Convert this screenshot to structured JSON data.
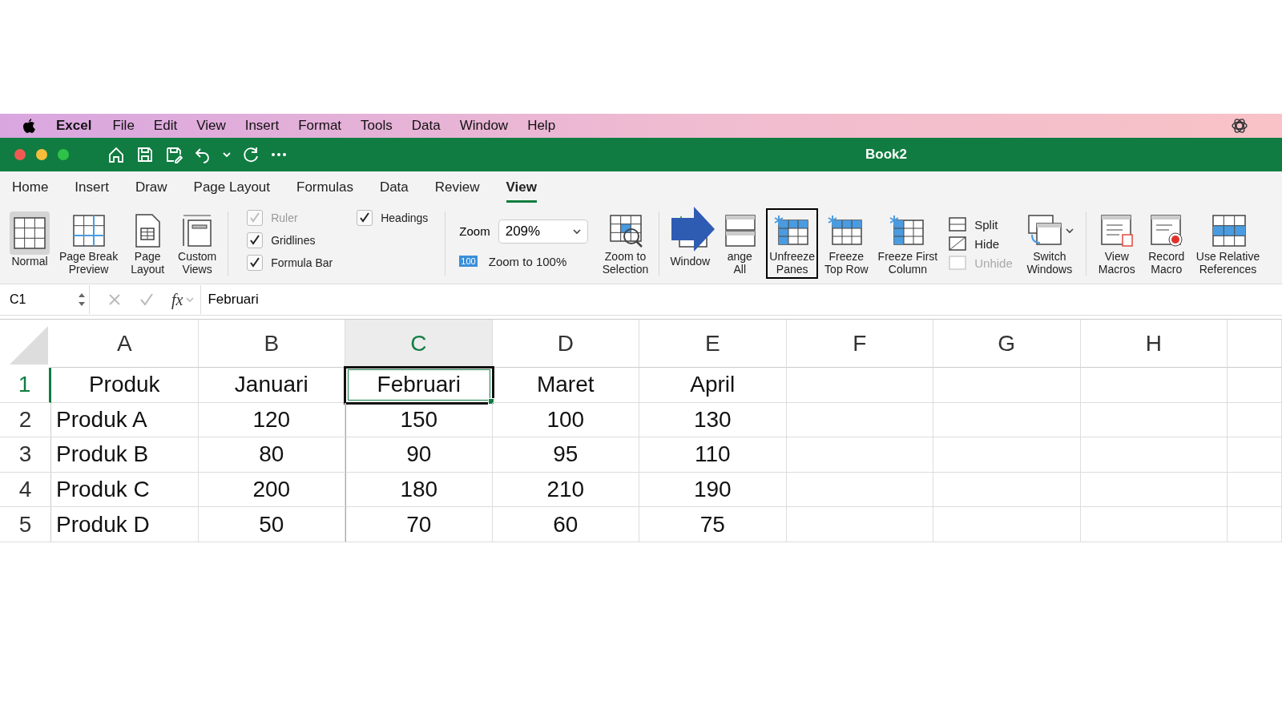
{
  "menu_bar": {
    "app": "Excel",
    "items": [
      "File",
      "Edit",
      "View",
      "Insert",
      "Format",
      "Tools",
      "Data",
      "Window",
      "Help"
    ]
  },
  "window": {
    "title": "Book2"
  },
  "tabs": [
    {
      "label": "Home",
      "selected": false
    },
    {
      "label": "Insert",
      "selected": false
    },
    {
      "label": "Draw",
      "selected": false
    },
    {
      "label": "Page Layout",
      "selected": false
    },
    {
      "label": "Formulas",
      "selected": false
    },
    {
      "label": "Data",
      "selected": false
    },
    {
      "label": "Review",
      "selected": false
    },
    {
      "label": "View",
      "selected": true
    }
  ],
  "ribbon": [
    {
      "items": [
        {
          "kind": "large",
          "lines": [
            "Normal"
          ],
          "selected": true
        },
        {
          "kind": "large",
          "lines": [
            "Page Break",
            "Preview"
          ],
          "selected": false
        },
        {
          "kind": "large",
          "lines": [
            "Page",
            "Layout"
          ],
          "selected": false
        },
        {
          "kind": "large",
          "lines": [
            "Custom",
            "Views"
          ],
          "selected": false
        }
      ]
    },
    {
      "items": [
        {
          "kind": "checks",
          "checks": [
            {
              "label": "Ruler",
              "checked": true,
              "disabled": true
            },
            {
              "label": "Gridlines",
              "checked": true,
              "disabled": false
            },
            {
              "label": "Formula Bar",
              "checked": true,
              "disabled": false
            }
          ]
        },
        {
          "kind": "checks",
          "checks": [
            {
              "label": "Headings",
              "checked": true,
              "disabled": false
            }
          ]
        }
      ]
    },
    {
      "items": [
        {
          "kind": "zoom",
          "label": "Zoom",
          "value": "209%",
          "badge": "100",
          "reset": "Zoom to 100%"
        },
        {
          "kind": "large",
          "lines": [
            "Zoom to",
            "Selection"
          ]
        }
      ]
    },
    {
      "items": [
        {
          "kind": "large",
          "lines": [
            "Window"
          ],
          "outlined": false
        },
        {
          "kind": "large",
          "lines": [
            "ange",
            "All"
          ],
          "outlined": false
        },
        {
          "kind": "large",
          "lines": [
            "Unfreeze",
            "Panes"
          ],
          "outlined": true
        },
        {
          "kind": "large",
          "lines": [
            "Freeze",
            "Top Row"
          ],
          "outlined": false
        },
        {
          "kind": "large",
          "lines": [
            "Freeze First",
            "Column"
          ],
          "outlined": false
        },
        {
          "kind": "stack",
          "buttons": [
            {
              "label": "Split",
              "disabled": false
            },
            {
              "label": "Hide",
              "disabled": false
            },
            {
              "label": "Unhide",
              "disabled": true
            }
          ]
        },
        {
          "kind": "large",
          "lines": [
            "Switch",
            "Windows"
          ]
        }
      ]
    },
    {
      "items": [
        {
          "kind": "large",
          "lines": [
            "View",
            "Macros"
          ]
        },
        {
          "kind": "large",
          "lines": [
            "Record",
            "Macro"
          ]
        },
        {
          "kind": "large",
          "lines": [
            "Use Relative",
            "References"
          ]
        }
      ]
    }
  ],
  "formula_bar": {
    "name_box": "C1",
    "function_label": "fx",
    "value": "Februari"
  },
  "sheet": {
    "columns": [
      {
        "label": "A",
        "selected": false
      },
      {
        "label": "B",
        "selected": false
      },
      {
        "label": "C",
        "selected": true
      },
      {
        "label": "D",
        "selected": false
      },
      {
        "label": "E",
        "selected": false
      },
      {
        "label": "F",
        "selected": false
      },
      {
        "label": "G",
        "selected": false
      },
      {
        "label": "H",
        "selected": false
      }
    ],
    "rows": [
      {
        "label": "1",
        "selected": true,
        "cells": [
          {
            "text": "Produk",
            "selected": false
          },
          {
            "text": "Januari",
            "selected": false
          },
          {
            "text": "Februari",
            "selected": true
          },
          {
            "text": "Maret",
            "selected": false
          },
          {
            "text": "April",
            "selected": false
          }
        ]
      },
      {
        "label": "2",
        "selected": false,
        "cells": [
          {
            "text": "Produk A",
            "selected": false
          },
          {
            "text": "120",
            "selected": false
          },
          {
            "text": "150",
            "selected": false
          },
          {
            "text": "100",
            "selected": false
          },
          {
            "text": "130",
            "selected": false
          }
        ]
      },
      {
        "label": "3",
        "selected": false,
        "cells": [
          {
            "text": "Produk B",
            "selected": false
          },
          {
            "text": "80",
            "selected": false
          },
          {
            "text": "90",
            "selected": false
          },
          {
            "text": "95",
            "selected": false
          },
          {
            "text": "110",
            "selected": false
          }
        ]
      },
      {
        "label": "4",
        "selected": false,
        "cells": [
          {
            "text": "Produk C",
            "selected": false
          },
          {
            "text": "200",
            "selected": false
          },
          {
            "text": "180",
            "selected": false
          },
          {
            "text": "210",
            "selected": false
          },
          {
            "text": "190",
            "selected": false
          }
        ]
      },
      {
        "label": "5",
        "selected": false,
        "cells": [
          {
            "text": "Produk D",
            "selected": false
          },
          {
            "text": "50",
            "selected": false
          },
          {
            "text": "70",
            "selected": false
          },
          {
            "text": "60",
            "selected": false
          },
          {
            "text": "75",
            "selected": false
          }
        ]
      }
    ]
  }
}
